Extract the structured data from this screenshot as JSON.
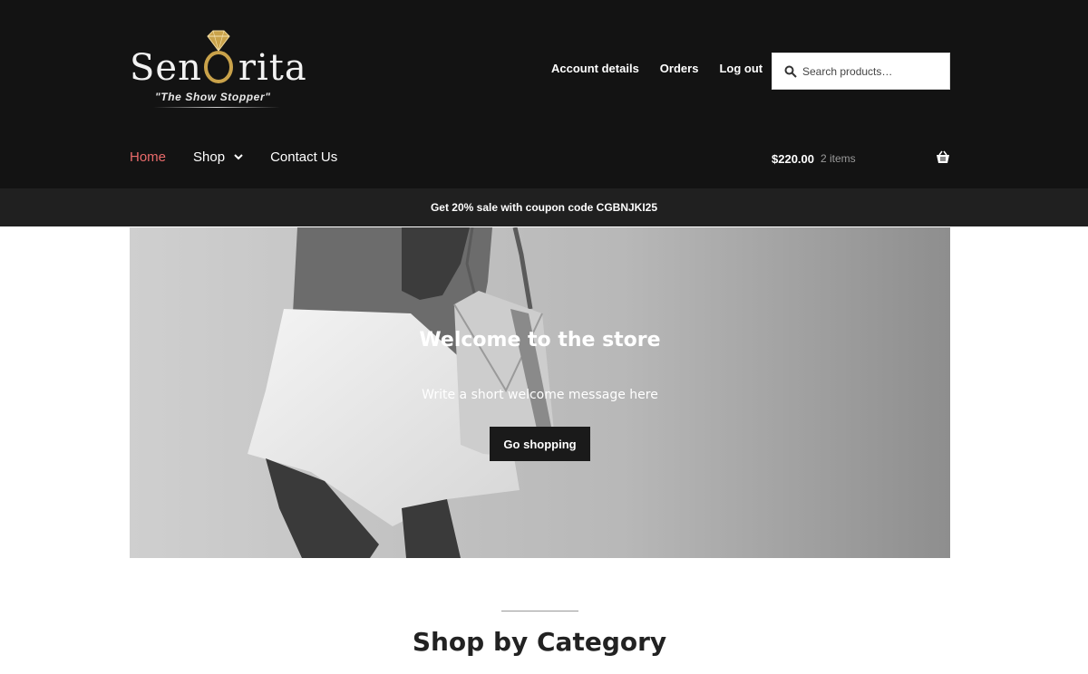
{
  "brand": {
    "name_start": "Sen",
    "name_end": "rita",
    "tagline": "\"The Show Stopper\""
  },
  "account_nav": [
    {
      "label": "Account details"
    },
    {
      "label": "Orders"
    },
    {
      "label": "Log out"
    }
  ],
  "search": {
    "placeholder": "Search products…"
  },
  "primary_nav": [
    {
      "label": "Home",
      "active": true
    },
    {
      "label": "Shop",
      "has_dropdown": true
    },
    {
      "label": "Contact Us"
    }
  ],
  "cart": {
    "amount": "$220.00",
    "count": "2 items",
    "icon": "basket-icon"
  },
  "notice": {
    "text": "Get 20% sale with coupon code CGBNJKI25"
  },
  "hero": {
    "title": "Welcome to the store",
    "text": "Write a short welcome message here",
    "button_label": "Go shopping"
  },
  "section": {
    "title": "Shop by Category"
  },
  "colors": {
    "header_bg": "#131313",
    "notice_bg": "#202020",
    "active_nav": "#e96b6b",
    "button_bg": "#1a1a1a",
    "logo_gold": "#c9a24a"
  }
}
